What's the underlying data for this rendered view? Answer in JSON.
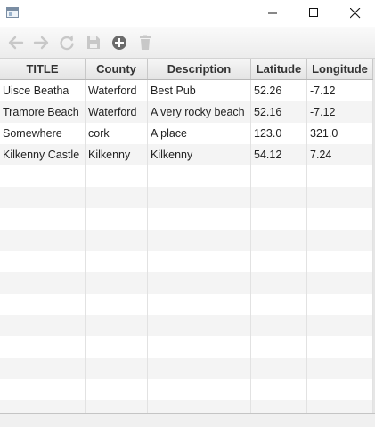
{
  "window": {
    "icons": {
      "app": "window-app-icon",
      "minimize": "minimize-icon",
      "maximize": "maximize-icon",
      "close": "close-icon"
    }
  },
  "toolbar": {
    "buttons": [
      {
        "icon": "arrow-left-icon",
        "enabled": false
      },
      {
        "icon": "arrow-right-icon",
        "enabled": false
      },
      {
        "icon": "refresh-icon",
        "enabled": false
      },
      {
        "icon": "save-icon",
        "enabled": false
      },
      {
        "icon": "plus-circle-icon",
        "enabled": true
      },
      {
        "icon": "trash-icon",
        "enabled": false
      }
    ]
  },
  "table": {
    "columns": [
      "TITLE",
      "County",
      "Description",
      "Latitude",
      "Longitude"
    ],
    "rows": [
      [
        "Uisce Beatha",
        "Waterford",
        "Best Pub",
        "52.26",
        "-7.12"
      ],
      [
        "Tramore Beach",
        "Waterford",
        "A very rocky beach",
        "52.16",
        "-7.12"
      ],
      [
        "Somewhere",
        "cork",
        "A place",
        "123.0",
        "321.0"
      ],
      [
        "Kilkenny Castle",
        "Kilkenny",
        "Kilkenny",
        "54.12",
        "7.24"
      ]
    ],
    "empty_row_count": 12
  },
  "colors": {
    "disabled_icon": "#c8c8c8",
    "enabled_icon": "#6b6b6b",
    "alt_row": "#f4f4f4"
  }
}
